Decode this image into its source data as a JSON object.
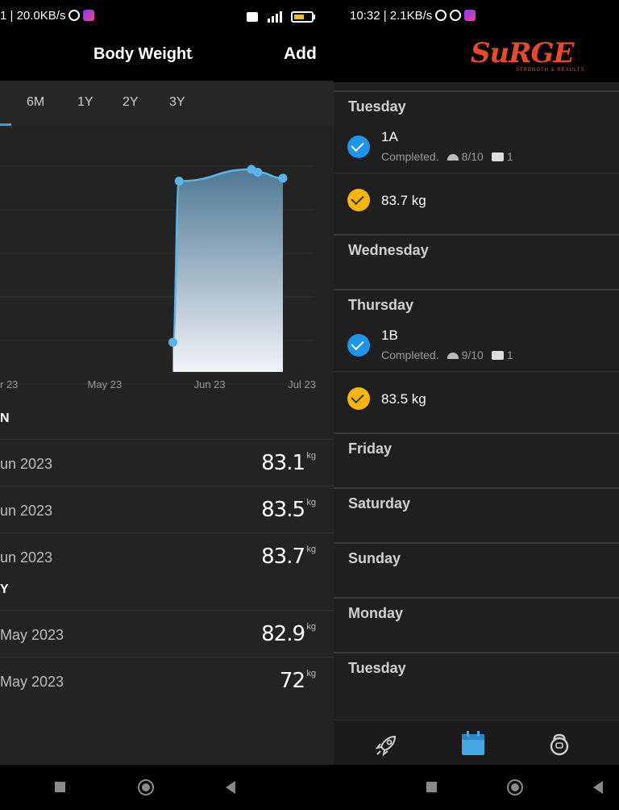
{
  "left": {
    "status": {
      "text": "1 | 20.0KB/s"
    },
    "header": {
      "title": "Body Weight",
      "add_label": "Add"
    },
    "tabs": [
      {
        "label": "6M"
      },
      {
        "label": "1Y"
      },
      {
        "label": "2Y"
      },
      {
        "label": "3Y"
      }
    ],
    "chart_data": {
      "type": "area",
      "x_ticks": [
        "r 23",
        "May 23",
        "Jun 23",
        "Jul 23"
      ],
      "x_tick_positions": [
        0.0,
        0.333,
        0.667,
        1.0
      ],
      "points": [
        {
          "x": 0.55,
          "y": 72.0
        },
        {
          "x": 0.57,
          "y": 82.9
        },
        {
          "x": 0.8,
          "y": 83.7
        },
        {
          "x": 0.82,
          "y": 83.5
        },
        {
          "x": 0.9,
          "y": 83.1
        }
      ],
      "ylim": [
        70,
        85
      ],
      "color": "#5ab4ea"
    },
    "groups": [
      {
        "label": "N",
        "entries": [
          {
            "date": "un 2023",
            "value": "83.1",
            "unit": "kg"
          },
          {
            "date": "un 2023",
            "value": "83.5",
            "unit": "kg"
          },
          {
            "date": "un 2023",
            "value": "83.7",
            "unit": "kg"
          }
        ]
      },
      {
        "label": "Y",
        "entries": [
          {
            "date": "May 2023",
            "value": "82.9",
            "unit": "kg"
          },
          {
            "date": "May 2023",
            "value": "72",
            "unit": "kg"
          }
        ]
      }
    ]
  },
  "right": {
    "status": {
      "text": "10:32 | 2.1KB/s"
    },
    "logo": {
      "text": "SuRGE",
      "sub": "STRENGTH & RESULTS"
    },
    "days": [
      {
        "name": "Tuesday",
        "items": [
          {
            "kind": "workout",
            "color": "blue",
            "name": "1A",
            "status": "Completed.",
            "rating": "8/10",
            "comments": "1"
          },
          {
            "kind": "weight",
            "color": "yellow",
            "name": "83.7 kg"
          }
        ]
      },
      {
        "name": "Wednesday",
        "items": []
      },
      {
        "name": "Thursday",
        "items": [
          {
            "kind": "workout",
            "color": "blue",
            "name": "1B",
            "status": "Completed.",
            "rating": "9/10",
            "comments": "1"
          },
          {
            "kind": "weight",
            "color": "yellow",
            "name": "83.5 kg"
          }
        ]
      },
      {
        "name": "Friday",
        "items": []
      },
      {
        "name": "Saturday",
        "items": []
      },
      {
        "name": "Sunday",
        "items": []
      },
      {
        "name": "Monday",
        "items": []
      },
      {
        "name": "Tuesday",
        "items": []
      }
    ],
    "bottom_tabs": [
      {
        "name": "rocket-icon"
      },
      {
        "name": "calendar-icon",
        "active": true
      },
      {
        "name": "kettlebell-icon"
      }
    ]
  },
  "colors": {
    "accent": "#1e95e6",
    "weight": "#f8b50f",
    "logo": "#e24b30"
  }
}
